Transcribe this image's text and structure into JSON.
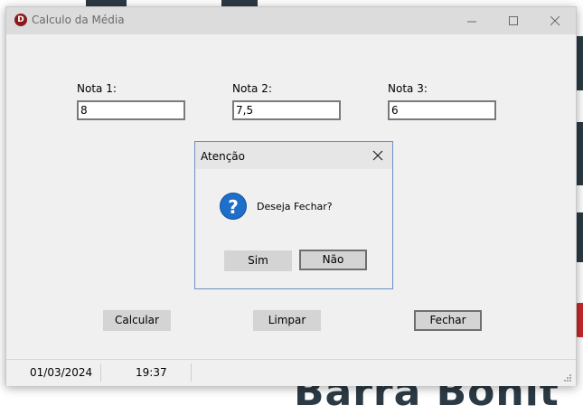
{
  "window": {
    "title": "Calculo da Média",
    "app_icon_letter": "D"
  },
  "form": {
    "nota1": {
      "label": "Nota 1:",
      "value": "8"
    },
    "nota2": {
      "label": "Nota 2:",
      "value": "7,5"
    },
    "nota3": {
      "label": "Nota 3:",
      "value": "6"
    }
  },
  "buttons": {
    "calcular": "Calcular",
    "limpar": "Limpar",
    "fechar": "Fechar"
  },
  "statusbar": {
    "date": "01/03/2024",
    "time": "19:37"
  },
  "dialog": {
    "title": "Atenção",
    "icon": "question-icon",
    "icon_glyph": "?",
    "message": "Deseja Fechar?",
    "yes_label": "Sim",
    "no_label": "Não"
  },
  "background": {
    "visible_text": "Barra Bonit"
  }
}
